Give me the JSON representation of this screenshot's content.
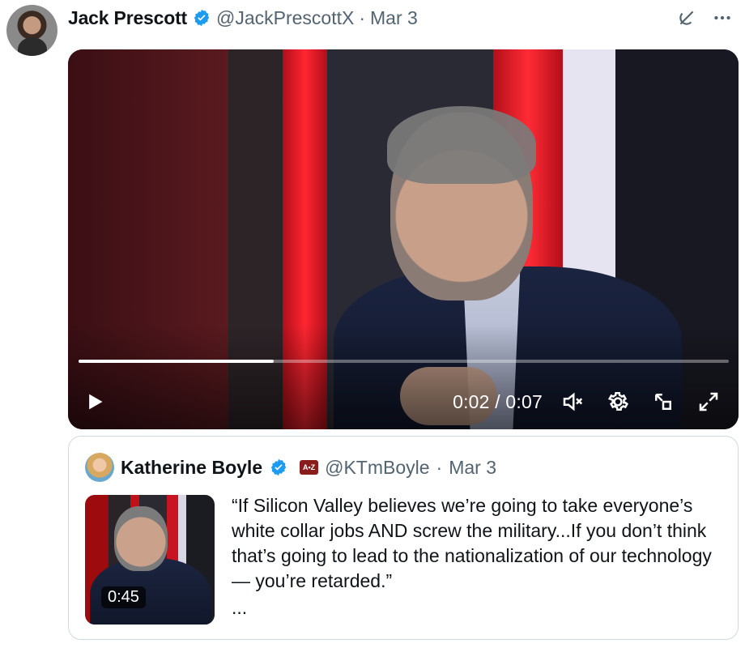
{
  "post": {
    "author": {
      "name": "Jack Prescott",
      "handle": "@JackPrescottX",
      "separator": "·",
      "date": "Mar 3"
    },
    "icons": {
      "verified": "verified-badge-icon",
      "grok": "grok-icon",
      "more": "more-icon"
    },
    "video": {
      "time_label": "0:02 / 0:07",
      "progress_fraction": 0.3,
      "controls": {
        "play": "play-icon",
        "mute": "mute-icon",
        "settings": "settings-icon",
        "pip": "pip-icon",
        "fullscreen": "fullscreen-icon"
      }
    }
  },
  "quoted": {
    "author": {
      "name": "Katherine Boyle",
      "org_badge": "A•Z",
      "handle": "@KTmBoyle",
      "separator": "·",
      "date": "Mar 3"
    },
    "thumbnail": {
      "duration": "0:45"
    },
    "text": "“If Silicon Valley believes we’re going to take everyone’s white collar jobs AND screw the military...If you don’t think that’s going to lead to the nationalization of our technology— you’re retarded.”",
    "more": "..."
  },
  "colors": {
    "accent": "#1d9bf0",
    "muted_text": "#536471",
    "border": "#cfd9de"
  }
}
